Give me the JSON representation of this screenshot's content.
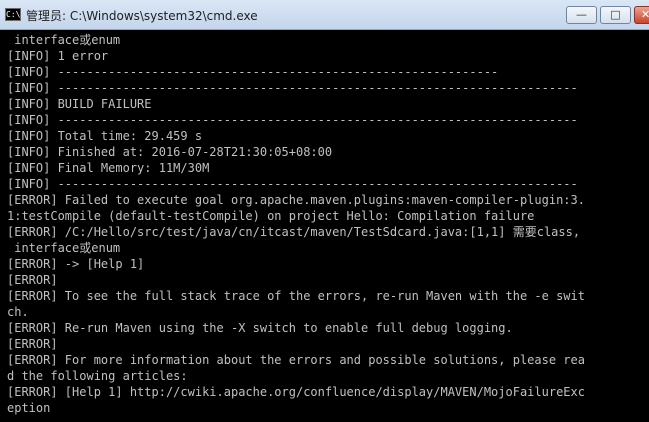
{
  "window": {
    "title": "管理员: C:\\Windows\\system32\\cmd.exe",
    "icon_text": "C:\\",
    "buttons": {
      "minimize": "—",
      "maximize": "□",
      "close": "✕"
    }
  },
  "console": {
    "lines": [
      " interface或enum",
      "[INFO] 1 error",
      "[INFO] -------------------------------------------------------------",
      "[INFO] ------------------------------------------------------------------------",
      "[INFO] BUILD FAILURE",
      "[INFO] ------------------------------------------------------------------------",
      "[INFO] Total time: 29.459 s",
      "[INFO] Finished at: 2016-07-28T21:30:05+08:00",
      "[INFO] Final Memory: 11M/30M",
      "[INFO] ------------------------------------------------------------------------",
      "[ERROR] Failed to execute goal org.apache.maven.plugins:maven-compiler-plugin:3.",
      "1:testCompile (default-testCompile) on project Hello: Compilation failure",
      "[ERROR] /C:/Hello/src/test/java/cn/itcast/maven/TestSdcard.java:[1,1] 需要class,",
      " interface或enum",
      "[ERROR] -> [Help 1]",
      "[ERROR]",
      "[ERROR] To see the full stack trace of the errors, re-run Maven with the -e swit",
      "ch.",
      "[ERROR] Re-run Maven using the -X switch to enable full debug logging.",
      "[ERROR]",
      "[ERROR] For more information about the errors and possible solutions, please rea",
      "d the following articles:",
      "[ERROR] [Help 1] http://cwiki.apache.org/confluence/display/MAVEN/MojoFailureExc",
      "eption"
    ]
  }
}
